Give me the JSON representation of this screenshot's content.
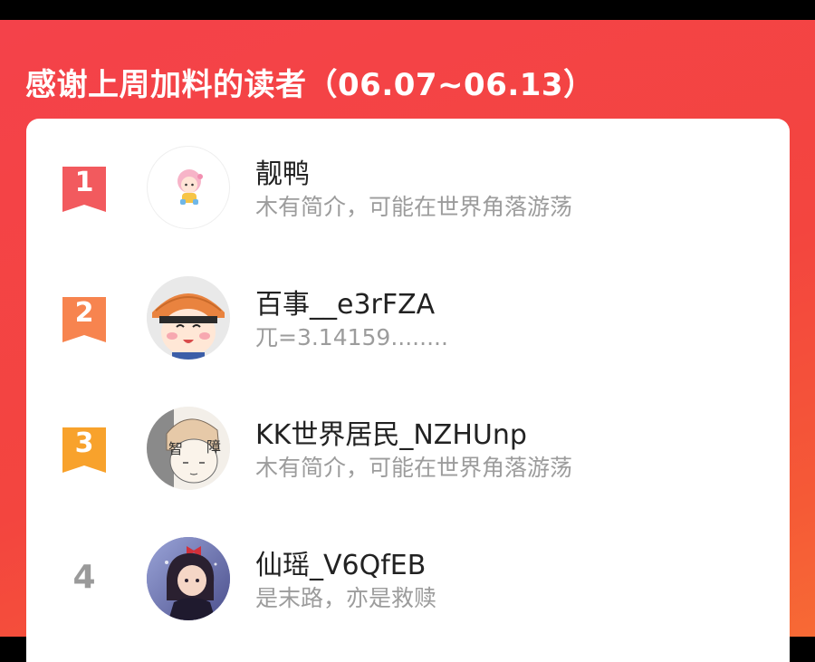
{
  "header": {
    "title": "感谢上周加料的读者（06.07~06.13）"
  },
  "colors": {
    "brand_red": "#f3453f",
    "rank1": "#f25a5e",
    "rank2": "#f7844f",
    "rank3": "#f8a22c",
    "rank_plain": "#9a9a9a"
  },
  "readers": [
    {
      "rank": "1",
      "name": "靓鸭",
      "bio": "木有简介，可能在世界角落游荡",
      "avatar_icon": "cartoon-girl-avatar"
    },
    {
      "rank": "2",
      "name": "百事__e3rFZA",
      "bio": "兀=3.14159........",
      "avatar_icon": "maruko-avatar"
    },
    {
      "rank": "3",
      "name": "KK世界居民_NZHUnp",
      "bio": "木有简介，可能在世界角落游荡",
      "avatar_icon": "sketch-boy-avatar"
    },
    {
      "rank": "4",
      "name": "仙瑶_V6QfEB",
      "bio": "是末路，亦是救赎",
      "avatar_icon": "anime-girl-avatar"
    }
  ],
  "avatar_texts": {
    "sketch_left": "智",
    "sketch_right": "障"
  }
}
